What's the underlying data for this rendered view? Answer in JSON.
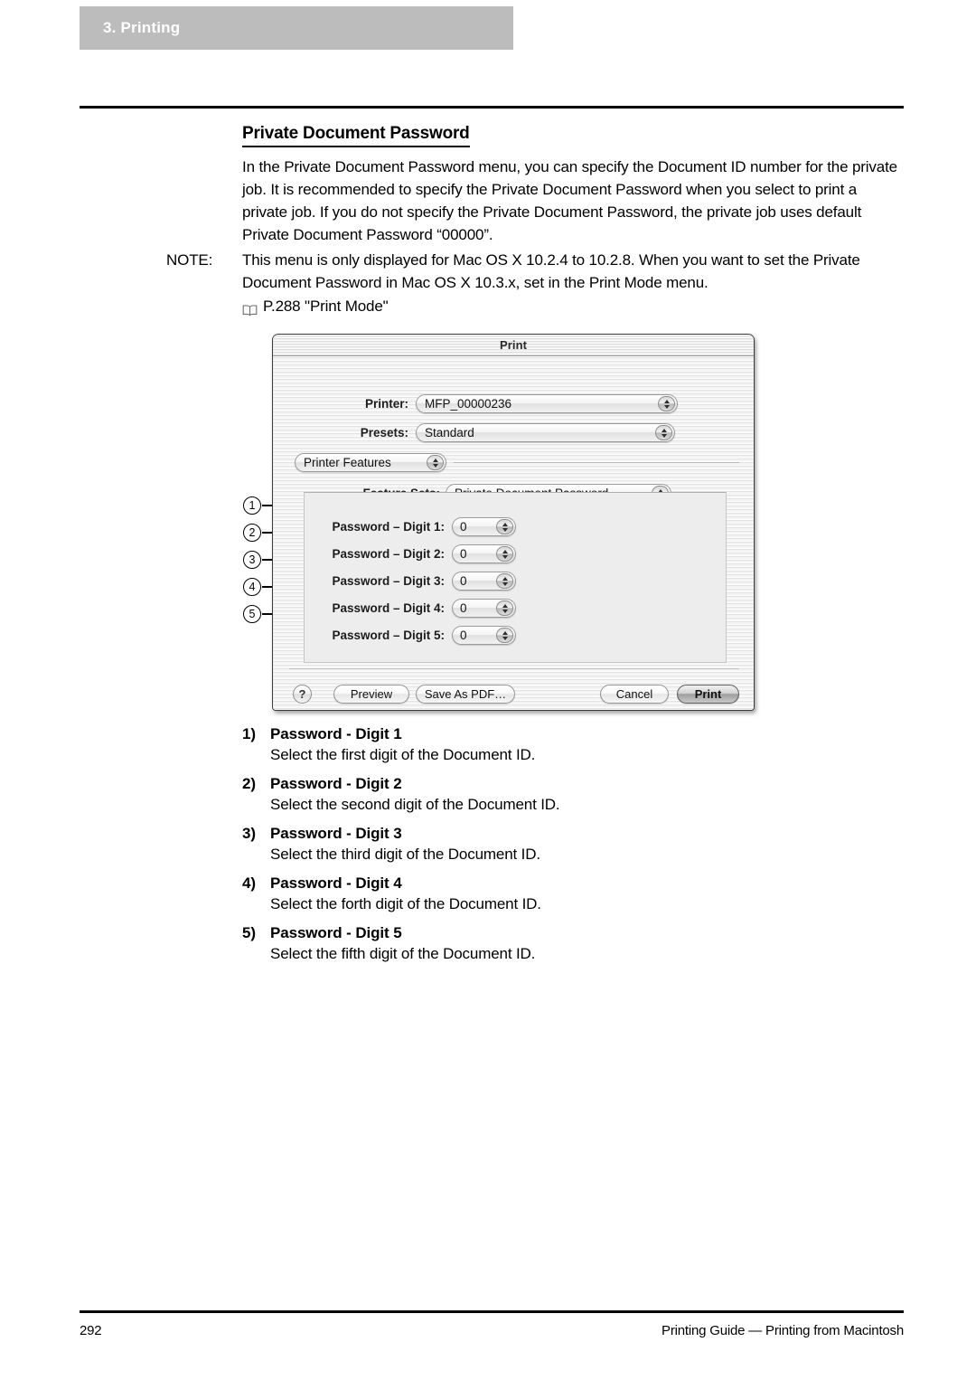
{
  "chapter": {
    "tab_label": "3. Printing"
  },
  "section": {
    "title": "Private Document Password",
    "paragraph": "In the Private Document Password menu, you can specify the Document ID number for the private job.  It is recommended to specify the Private Document Password when you select to print a private job.  If you do not specify the Private Document Password, the private job uses default Private Document Password “00000”."
  },
  "note": {
    "label": "NOTE:",
    "line1": "This menu is only displayed for Mac OS X 10.2.4 to 10.2.8.  When you want to set the Private Document Password in Mac OS X 10.3.x, set in the Print Mode menu.",
    "reference": "P.288 \"Print Mode\""
  },
  "dialog": {
    "title": "Print",
    "printer_label": "Printer:",
    "printer_value": "MFP_00000236",
    "presets_label": "Presets:",
    "presets_value": "Standard",
    "pane_value": "Printer Features",
    "feature_sets_label": "Feature Sets:",
    "feature_sets_value": "Private Document Password",
    "digits": [
      {
        "label": "Password – Digit 1:",
        "value": "0"
      },
      {
        "label": "Password – Digit 2:",
        "value": "0"
      },
      {
        "label": "Password – Digit 3:",
        "value": "0"
      },
      {
        "label": "Password – Digit 4:",
        "value": "0"
      },
      {
        "label": "Password – Digit 5:",
        "value": "0"
      }
    ],
    "help_label": "?",
    "preview_label": "Preview",
    "save_pdf_label": "Save As PDF…",
    "cancel_label": "Cancel",
    "print_label": "Print"
  },
  "callouts": [
    "1",
    "2",
    "3",
    "4",
    "5"
  ],
  "descriptions": [
    {
      "num": "1)",
      "title": "Password - Digit 1",
      "text": "Select the first digit of the Document ID."
    },
    {
      "num": "2)",
      "title": "Password - Digit 2",
      "text": "Select the second digit of the Document ID."
    },
    {
      "num": "3)",
      "title": "Password - Digit 3",
      "text": "Select the third digit of the Document ID."
    },
    {
      "num": "4)",
      "title": "Password - Digit 4",
      "text": "Select the forth digit of the Document ID."
    },
    {
      "num": "5)",
      "title": "Password - Digit 5",
      "text": "Select the fifth digit of the Document ID."
    }
  ],
  "footer": {
    "page_number": "292",
    "guide_text": "Printing Guide — Printing from Macintosh"
  }
}
